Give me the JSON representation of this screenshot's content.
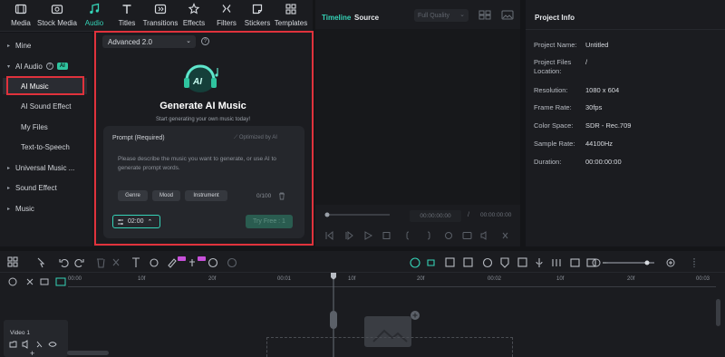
{
  "asset_tabs": [
    {
      "label": "Media",
      "icon": "media-icon"
    },
    {
      "label": "Stock Media",
      "icon": "stock-media-icon"
    },
    {
      "label": "Audio",
      "icon": "audio-icon",
      "active": true
    },
    {
      "label": "Titles",
      "icon": "titles-icon"
    },
    {
      "label": "Transitions",
      "icon": "transitions-icon"
    },
    {
      "label": "Effects",
      "icon": "effects-icon"
    },
    {
      "label": "Filters",
      "icon": "filters-icon"
    },
    {
      "label": "Stickers",
      "icon": "stickers-icon"
    },
    {
      "label": "Templates",
      "icon": "templates-icon"
    }
  ],
  "sidebar": {
    "items": [
      {
        "label": "Mine"
      },
      {
        "label": "AI Audio",
        "badge": "AI"
      },
      {
        "label": "AI Music",
        "selected": true
      },
      {
        "label": "AI Sound Effect"
      },
      {
        "label": "My Files"
      },
      {
        "label": "Text-to-Speech"
      },
      {
        "label": "Universal Music ..."
      },
      {
        "label": "Sound Effect"
      },
      {
        "label": "Music"
      }
    ]
  },
  "generator": {
    "model": "Advanced 2.0",
    "title": "Generate AI Music",
    "subtitle": "Start generating your own music today!",
    "prompt_label": "Prompt (Required)",
    "optimized_label": "Optimized by AI",
    "prompt_placeholder": "Please describe the music you want to generate, or use AI to generate prompt words.",
    "chips": [
      "Genre",
      "Mood",
      "Instrument"
    ],
    "counter": "0/100",
    "duration": "02:00",
    "try_button": "Try Free : 1"
  },
  "preview": {
    "tab_timeline": "Timeline",
    "tab_source": "Source",
    "quality": "Full Quality",
    "time_current": "00:00:00:00",
    "time_separator": "/",
    "time_total": "00:00:00:00"
  },
  "project_info": {
    "title": "Project Info",
    "rows": [
      {
        "label": "Project Name:",
        "value": "Untitled"
      },
      {
        "label": "Project Files Location:",
        "value": "/"
      },
      {
        "label": "Resolution:",
        "value": "1080 x 604"
      },
      {
        "label": "Frame Rate:",
        "value": "30fps"
      },
      {
        "label": "Color Space:",
        "value": "SDR - Rec.709"
      },
      {
        "label": "Sample Rate:",
        "value": "44100Hz"
      },
      {
        "label": "Duration:",
        "value": "00:00:00:00"
      }
    ]
  },
  "timeline": {
    "ruler": [
      "00:00",
      "10f",
      "20f",
      "00:01",
      "10f",
      "20f",
      "00:02",
      "10f",
      "20f",
      "00:03"
    ],
    "track_name": "Video 1",
    "badges": [
      "NEW",
      "NEW",
      "NEW"
    ]
  },
  "colors": {
    "accent": "#35d3b7",
    "highlight": "#e0323c",
    "background": "#141518",
    "panel": "#1b1c20"
  }
}
